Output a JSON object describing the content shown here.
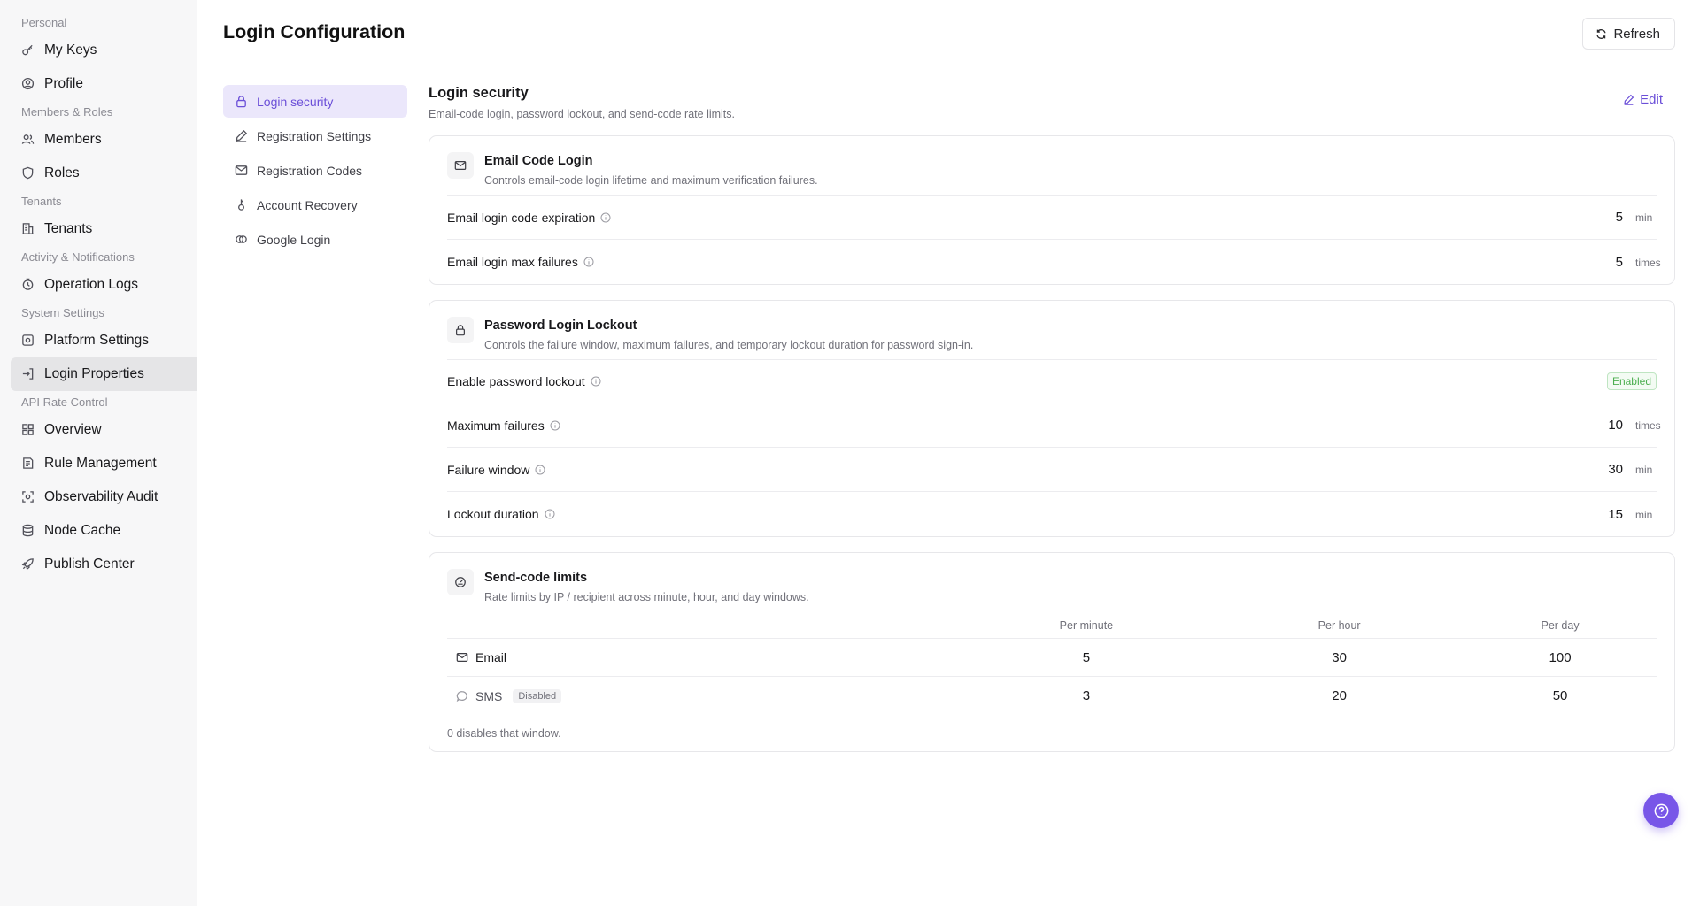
{
  "sidebar": {
    "groups": [
      {
        "label": "Personal",
        "items": [
          {
            "label": "My Keys",
            "icon": "key-icon"
          },
          {
            "label": "Profile",
            "icon": "user-circle-icon"
          }
        ]
      },
      {
        "label": "Members & Roles",
        "items": [
          {
            "label": "Members",
            "icon": "users-icon"
          },
          {
            "label": "Roles",
            "icon": "shield-icon"
          }
        ]
      },
      {
        "label": "Tenants",
        "items": [
          {
            "label": "Tenants",
            "icon": "building-icon"
          }
        ]
      },
      {
        "label": "Activity & Notifications",
        "items": [
          {
            "label": "Operation Logs",
            "icon": "log-icon"
          }
        ]
      },
      {
        "label": "System Settings",
        "items": [
          {
            "label": "Platform Settings",
            "icon": "settings-icon"
          },
          {
            "label": "Login Properties",
            "icon": "login-icon",
            "active": true
          }
        ]
      },
      {
        "label": "API Rate Control",
        "items": [
          {
            "label": "Overview",
            "icon": "grid-icon"
          },
          {
            "label": "Rule Management",
            "icon": "rules-icon"
          },
          {
            "label": "Observability Audit",
            "icon": "scan-icon"
          },
          {
            "label": "Node Cache",
            "icon": "database-icon"
          },
          {
            "label": "Publish Center",
            "icon": "rocket-icon"
          }
        ]
      }
    ]
  },
  "header": {
    "title": "Login Configuration",
    "refresh_label": "Refresh"
  },
  "subnav": {
    "items": [
      {
        "label": "Login security",
        "icon": "lock-icon",
        "active": true
      },
      {
        "label": "Registration Settings",
        "icon": "pen-icon"
      },
      {
        "label": "Registration Codes",
        "icon": "mail-icon"
      },
      {
        "label": "Account Recovery",
        "icon": "key-icon"
      },
      {
        "label": "Google Login",
        "icon": "link-icon"
      }
    ]
  },
  "section": {
    "title": "Login security",
    "description": "Email-code login, password lockout, and send-code rate limits.",
    "edit_label": "Edit"
  },
  "email_card": {
    "title": "Email Code Login",
    "description": "Controls email-code login lifetime and maximum verification failures.",
    "rows": [
      {
        "label": "Email login code expiration",
        "value": "5",
        "unit": "min"
      },
      {
        "label": "Email login max failures",
        "value": "5",
        "unit": "times"
      }
    ]
  },
  "lockout_card": {
    "title": "Password Login Lockout",
    "description": "Controls the failure window, maximum failures, and temporary lockout duration for password sign-in.",
    "enable_label": "Enable password lockout",
    "enable_status": "Enabled",
    "rows": [
      {
        "label": "Maximum failures",
        "value": "10",
        "unit": "times"
      },
      {
        "label": "Failure window",
        "value": "30",
        "unit": "min"
      },
      {
        "label": "Lockout duration",
        "value": "15",
        "unit": "min"
      }
    ]
  },
  "rate_card": {
    "title": "Send-code limits",
    "description": "Rate limits by IP / recipient across minute, hour, and day windows.",
    "columns": [
      "Per minute",
      "Per hour",
      "Per day"
    ],
    "rows": [
      {
        "name": "Email",
        "per_minute": "5",
        "per_hour": "30",
        "per_day": "100"
      },
      {
        "name": "SMS",
        "badge": "Disabled",
        "per_minute": "3",
        "per_hour": "20",
        "per_day": "50"
      }
    ],
    "note": "0 disables that window."
  }
}
